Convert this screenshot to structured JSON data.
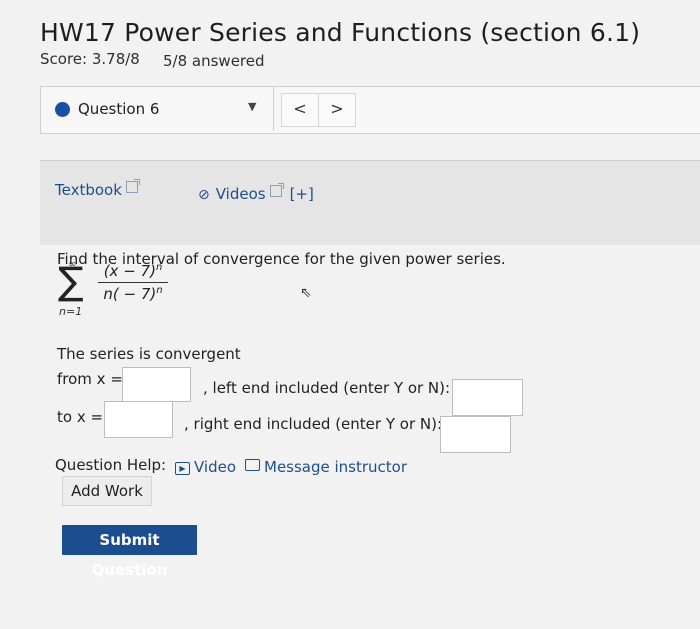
{
  "header": {
    "title": "HW17 Power Series and Functions (section 6.1)",
    "score": "Score: 3.78/8",
    "answered": "5/8 answered"
  },
  "question_nav": {
    "question_label": "Question 6",
    "caret": "▼",
    "prev": "<",
    "next": ">"
  },
  "resources": {
    "textbook": "Textbook",
    "videos": "Videos",
    "expand": "[+]"
  },
  "problem": {
    "prompt": "Find the interval of convergence for the given power series.",
    "sum_upper": "∞",
    "sum_lower": "n=1",
    "numerator": "(x − 7)",
    "numerator_exp": "n",
    "denominator": "n( − 7)",
    "denominator_exp": "n"
  },
  "answer": {
    "convergent_text": "The series is convergent",
    "from_label": "from x =",
    "left_end_label": ", left end included (enter Y or N):",
    "to_label": "to x =",
    "right_end_label": ", right end included (enter Y or N):",
    "from_value": "",
    "left_end_value": "",
    "to_value": "",
    "right_end_value": ""
  },
  "help": {
    "label": "Question Help:",
    "video": "Video",
    "message": "Message instructor",
    "add_work": "Add Work"
  },
  "submit_label": "Submit Question",
  "colors": {
    "accent": "#1b4d8f",
    "link": "#1e4f8c",
    "bullet": "#1b4fa6"
  }
}
